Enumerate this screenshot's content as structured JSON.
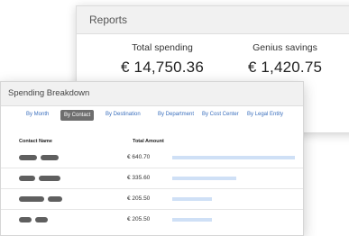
{
  "reports": {
    "title": "Reports",
    "total_spending_label": "Total spending",
    "total_spending_value": "€ 14,750.36",
    "genius_savings_label": "Genius savings",
    "genius_savings_value": "€ 1,420.75"
  },
  "breakdown": {
    "title": "Spending Breakdown",
    "tabs": [
      {
        "label": "By Month",
        "active": false
      },
      {
        "label": "By Contact",
        "active": true
      },
      {
        "label": "By Destination",
        "active": false
      },
      {
        "label": "By Department",
        "active": false
      },
      {
        "label": "By Cost Center",
        "active": false
      },
      {
        "label": "By Legal Entity",
        "active": false
      }
    ],
    "columns": {
      "contact": "Contact Name",
      "amount": "Total Amount"
    },
    "rows": [
      {
        "amount": "€ 640.70",
        "share": 1.0
      },
      {
        "amount": "€ 335.60",
        "share": 0.52
      },
      {
        "amount": "€ 205.50",
        "share": 0.32
      },
      {
        "amount": "€ 205.50",
        "share": 0.32
      }
    ]
  },
  "colors": {
    "bar": "#cfe0f6",
    "tab_active": "#6e6e6e",
    "link": "#3a6fbd"
  }
}
